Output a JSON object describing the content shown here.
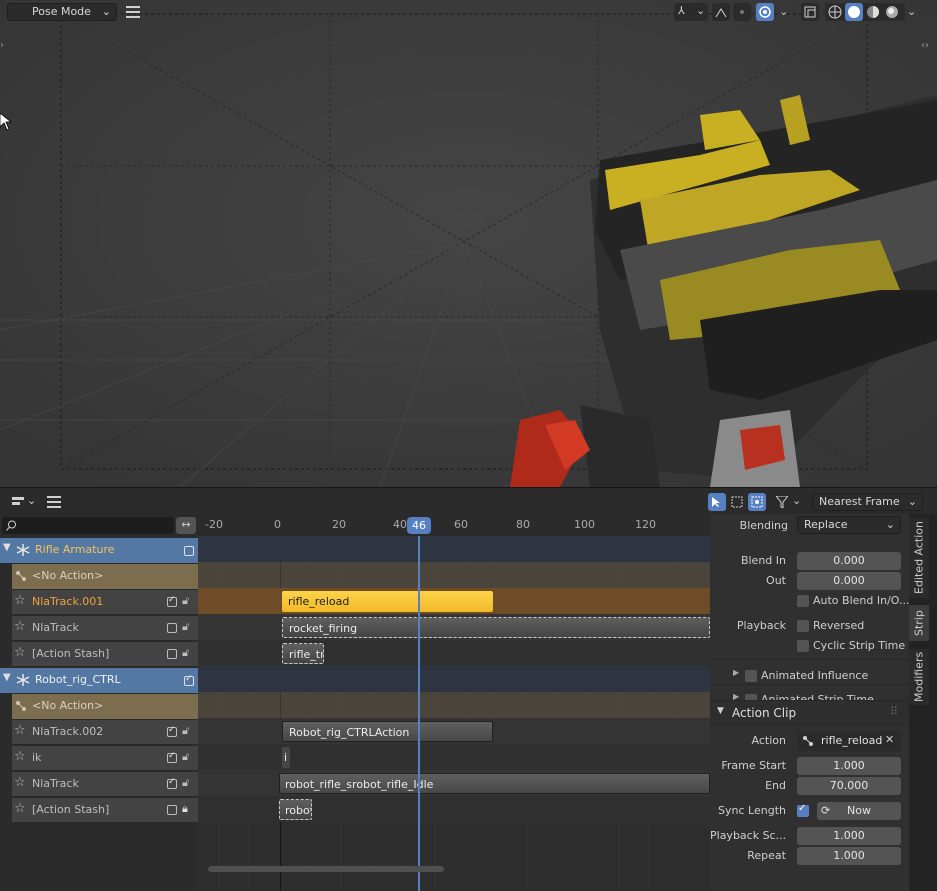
{
  "viewport": {
    "mode": "Pose Mode",
    "menu_icon": "hamburger-icon"
  },
  "nla_header": {
    "snap": "Nearest Frame"
  },
  "search": {
    "placeholder": ""
  },
  "timeline": {
    "ticks": [
      "-20",
      "0",
      "20",
      "40",
      "60",
      "80",
      "100",
      "120"
    ],
    "current_frame": "46"
  },
  "channels": {
    "group1": "Rifle Armature",
    "no_action": "<No Action>",
    "track_001": "NlaTrack.001",
    "track1": "NlaTrack",
    "stash1": "[Action Stash]",
    "group2": "Robot_rig_CTRL",
    "no_action2": "<No Action>",
    "track_002": "NlaTrack.002",
    "ik": "ik",
    "track2": "NlaTrack",
    "stash2": "[Action Stash]"
  },
  "strips": {
    "rifle_reload": "rifle_reload",
    "rocket_firing": "rocket_firing",
    "rifle_tran": "rifle_tran",
    "robot_ctrl_action": "Robot_rig_CTRLAction",
    "ik_strip": "i",
    "robot_idle": "robot_rifle_srobot_rifle_Idle",
    "robot_ri": "robot_ri"
  },
  "properties": {
    "blending_label": "Blending",
    "blending_value": "Replace",
    "blend_in_label": "Blend In",
    "blend_in_value": "0.000",
    "out_label": "Out",
    "out_value": "0.000",
    "auto_blend": "Auto Blend In/O...",
    "playback_label": "Playback",
    "reversed": "Reversed",
    "cyclic": "Cyclic Strip Time",
    "animated_influence": "Animated Influence",
    "animated_strip_time": "Animated Strip Time",
    "action_clip": "Action Clip",
    "action_label": "Action",
    "action_value": "rifle_reload",
    "frame_start_label": "Frame Start",
    "frame_start_value": "1.000",
    "end_label": "End",
    "end_value": "70.000",
    "sync_length_label": "Sync Length",
    "now_label": "Now",
    "playback_scale_label": "Playback Sc...",
    "playback_scale_value": "1.000",
    "repeat_label": "Repeat",
    "repeat_value": "1.000"
  },
  "tabs": [
    "Edited Action",
    "Strip",
    "Modifiers"
  ],
  "colors": {
    "accent_blue": "#5478a4",
    "active_strip": "#f1b92a",
    "playhead": "#5680c2",
    "track_brown": "#6e4c28"
  }
}
